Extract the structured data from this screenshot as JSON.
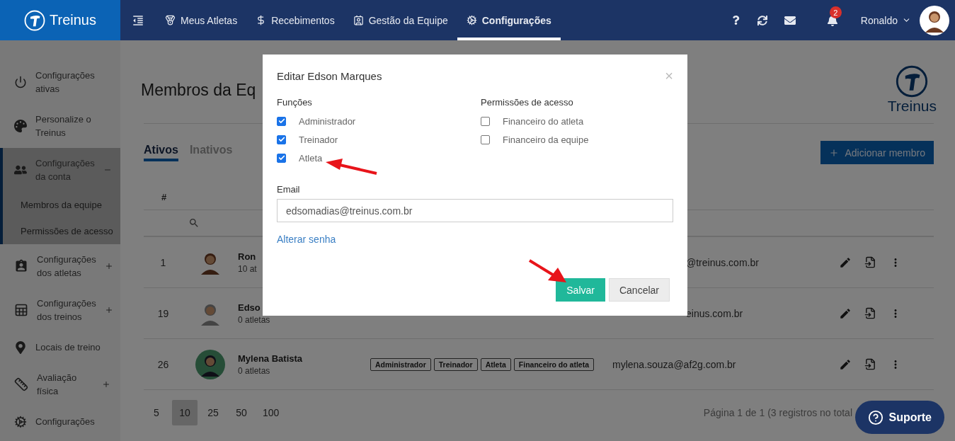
{
  "nav": {
    "logo": "Treinus",
    "items": [
      {
        "label": "Meus Atletas",
        "selected": false
      },
      {
        "label": "Recebimentos",
        "selected": false
      },
      {
        "label": "Gestão da Equipe",
        "selected": false
      },
      {
        "label": "Configurações",
        "selected": true
      }
    ],
    "notification_count": "2",
    "user": "Ronaldo"
  },
  "sidebar": {
    "items": [
      {
        "label": "Configurações ativas",
        "kind": "link",
        "selected": false
      },
      {
        "label": "Personalize o Treinus",
        "kind": "link",
        "selected": false
      },
      {
        "label": "Configurações da conta",
        "kind": "group",
        "selected": true,
        "expanded": true,
        "children": [
          {
            "label": "Membros da equipe"
          },
          {
            "label": "Permissões de acesso"
          }
        ]
      },
      {
        "label": "Configurações dos atletas",
        "kind": "group",
        "selected": false,
        "expanded": false
      },
      {
        "label": "Configurações dos treinos",
        "kind": "group",
        "selected": false,
        "expanded": false
      },
      {
        "label": "Locais de treino",
        "kind": "link",
        "selected": false
      },
      {
        "label": "Avaliação física",
        "kind": "group",
        "selected": false,
        "expanded": false
      },
      {
        "label": "Configurações",
        "kind": "link",
        "selected": false
      }
    ]
  },
  "page": {
    "title": "Membros da Eq",
    "logo": "Treinus",
    "tabs": [
      {
        "label": "Ativos",
        "selected": true
      },
      {
        "label": "Inativos",
        "selected": false
      }
    ],
    "add_button": "Adicionar membro",
    "table": {
      "columns": [
        "#"
      ],
      "rows": [
        {
          "number": "1",
          "name": "Ron",
          "athletes": "10 at",
          "email": "@treinus.com.br",
          "kind": "covered"
        },
        {
          "number": "19",
          "name": "Edso",
          "athletes": "0 atletas",
          "email": "einus.com.br",
          "kind": "covered"
        },
        {
          "number": "26",
          "name": "Mylena Batista",
          "athletes": "0 atletas",
          "roles": [
            "Administrador",
            "Treinador",
            "Atleta",
            "Financeiro do atleta"
          ],
          "email": "mylena.souza@af2g.com.br",
          "kind": "full"
        }
      ]
    },
    "page_sizes": [
      {
        "label": "5",
        "selected": false
      },
      {
        "label": "10",
        "selected": true
      },
      {
        "label": "25",
        "selected": false
      },
      {
        "label": "50",
        "selected": false
      },
      {
        "label": "100",
        "selected": false
      }
    ],
    "page_info": "Página 1 de 1 (3 registros no total"
  },
  "dialog": {
    "title": "Editar Edson Marques",
    "close": "×",
    "roles_heading": "Funções",
    "roles": [
      {
        "label": "Administrador",
        "checked": true
      },
      {
        "label": "Treinador",
        "checked": true
      },
      {
        "label": "Atleta",
        "checked": true
      }
    ],
    "permissions_heading": "Permissões de acesso",
    "permissions": [
      {
        "label": "Financeiro do atleta",
        "checked": false
      },
      {
        "label": "Financeiro da equipe",
        "checked": false
      }
    ],
    "email_label": "Email",
    "email": "edsomadias@treinus.com.br",
    "change_password": "Alterar senha",
    "buttons": [
      {
        "label": "Salvar",
        "kind": "primary"
      },
      {
        "label": "Cancelar",
        "kind": "secondary"
      }
    ]
  },
  "support_button": "Suporte"
}
